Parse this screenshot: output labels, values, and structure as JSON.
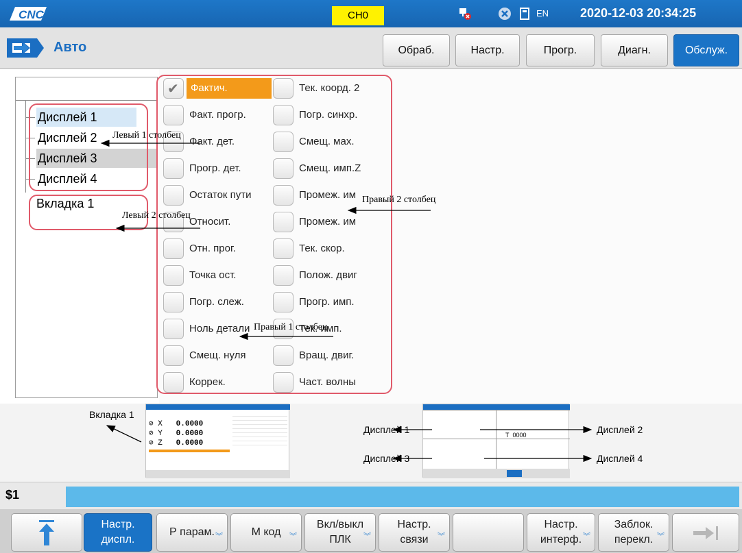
{
  "topbar": {
    "logo": "CNC",
    "channel": "CH0",
    "lang": "EN",
    "datetime": "2020-12-03 20:34:25",
    "colors": {
      "bar": "#1b6ec2",
      "channel": "#fff200"
    }
  },
  "mode": {
    "icon": "arrow-right-icon",
    "title": "Авто"
  },
  "nav": [
    "Обраб.",
    "Настр.",
    "Прогр.",
    "Диагн.",
    "Обслуж."
  ],
  "tree": {
    "items": [
      "Дисплей 1",
      "Дисплей 2",
      "Дисплей 3",
      "Дисплей 4"
    ],
    "tab": "Вкладка 1"
  },
  "checks": {
    "col1": [
      "Фактич.",
      "Факт. прогр.",
      "Факт. дет.",
      "Прогр. дет.",
      "Остаток пути",
      "Относит.",
      "Отн. прог.",
      "Точка ост.",
      "Погр. слеж.",
      "Ноль детали",
      "Смещ. нуля",
      "Коррек."
    ],
    "col2": [
      "Тек. коорд. 2",
      "Погр. синхр.",
      "Смещ. мах.",
      "Смещ. имп.Z",
      "Промеж. им",
      "Промеж. им",
      "Тек. скор.",
      "Полож. двиг",
      "Прогр. имп.",
      "Тек. имп.",
      "Вращ. двиг.",
      "Част. волны"
    ],
    "checked": "Фактич."
  },
  "annotations": {
    "left1": "Левый 1 столбец",
    "left2": "Левый 2 столбец",
    "right2": "Правый 2 столбец",
    "right1": "Правый 1 столбец"
  },
  "previews": {
    "tab": "Вкладка 1",
    "d1": "Дисплей 1",
    "d2": "Дисплей 2",
    "d3": "Дисплей 3",
    "d4": "Дисплей 4",
    "axes": [
      "X",
      "Y",
      "Z"
    ],
    "values": [
      "0.0000",
      "0.0000",
      "0.0000"
    ],
    "t_value": "0000"
  },
  "status": {
    "label": "$1",
    "value": ""
  },
  "softkeys": [
    {
      "label": "",
      "icon": "up-arrow-icon"
    },
    {
      "label": "Настр.\nдиспл."
    },
    {
      "label": "Р парам."
    },
    {
      "label": "М код"
    },
    {
      "label": "Вкл/выкл\nПЛК"
    },
    {
      "label": "Настр.\nсвязи"
    },
    {
      "label": ""
    },
    {
      "label": "Настр.\nинтерф."
    },
    {
      "label": "Заблок.\nперекл."
    },
    {
      "label": "",
      "icon": "next-page-icon"
    }
  ]
}
